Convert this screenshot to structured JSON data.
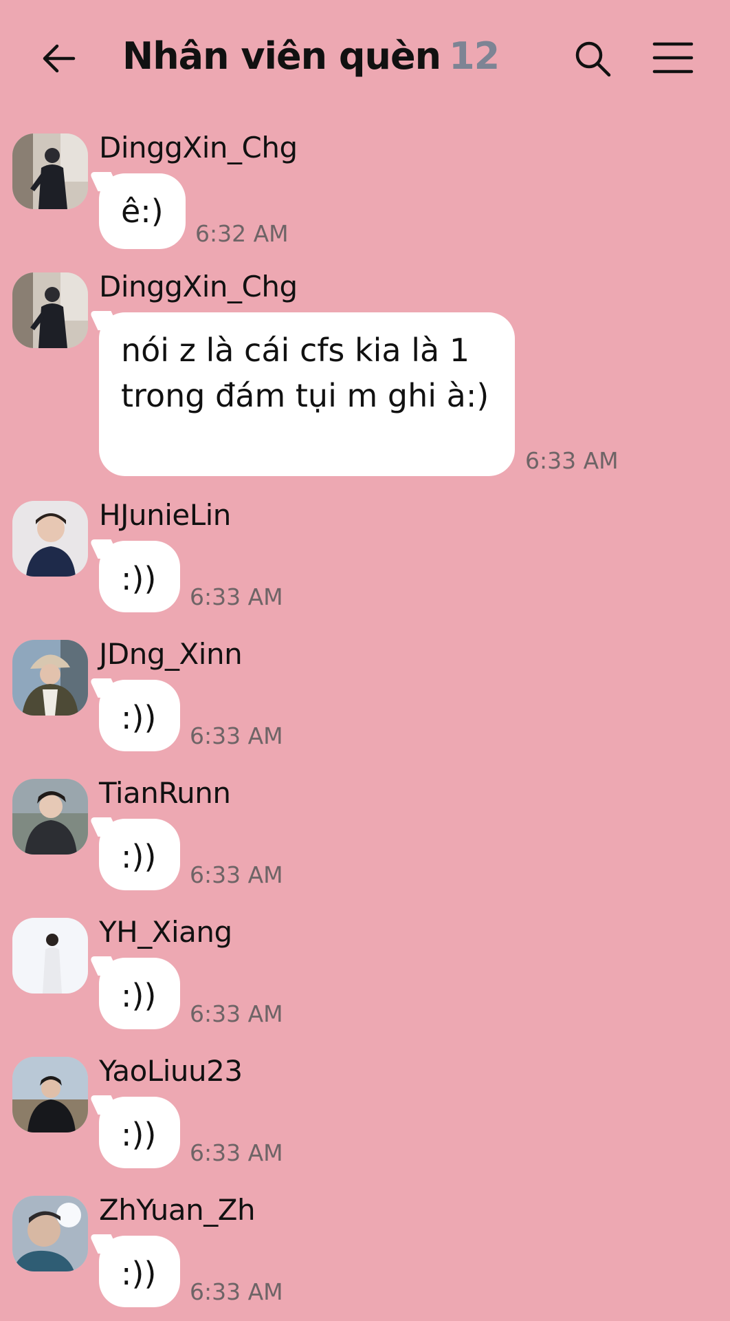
{
  "header": {
    "title": "Nhân viên quèn",
    "member_count": "12"
  },
  "messages": [
    {
      "sender": "DinggXin_Chg",
      "text": "ê:)",
      "time": "6:32 AM"
    },
    {
      "sender": "DinggXin_Chg",
      "text": "nói z là cái cfs kia là 1 trong đám tụi m ghi à:)",
      "time": "6:33 AM"
    },
    {
      "sender": "HJunieLin",
      "text": ":))",
      "time": "6:33 AM"
    },
    {
      "sender": "JDng_Xinn",
      "text": ":))",
      "time": "6:33 AM"
    },
    {
      "sender": "TianRunn",
      "text": ":))",
      "time": "6:33 AM"
    },
    {
      "sender": "YH_Xiang",
      "text": ":))",
      "time": "6:33 AM"
    },
    {
      "sender": "YaoLiuu23",
      "text": ":))",
      "time": "6:33 AM"
    },
    {
      "sender": "ZhYuan_Zh",
      "text": ":))",
      "time": "6:33 AM"
    }
  ]
}
